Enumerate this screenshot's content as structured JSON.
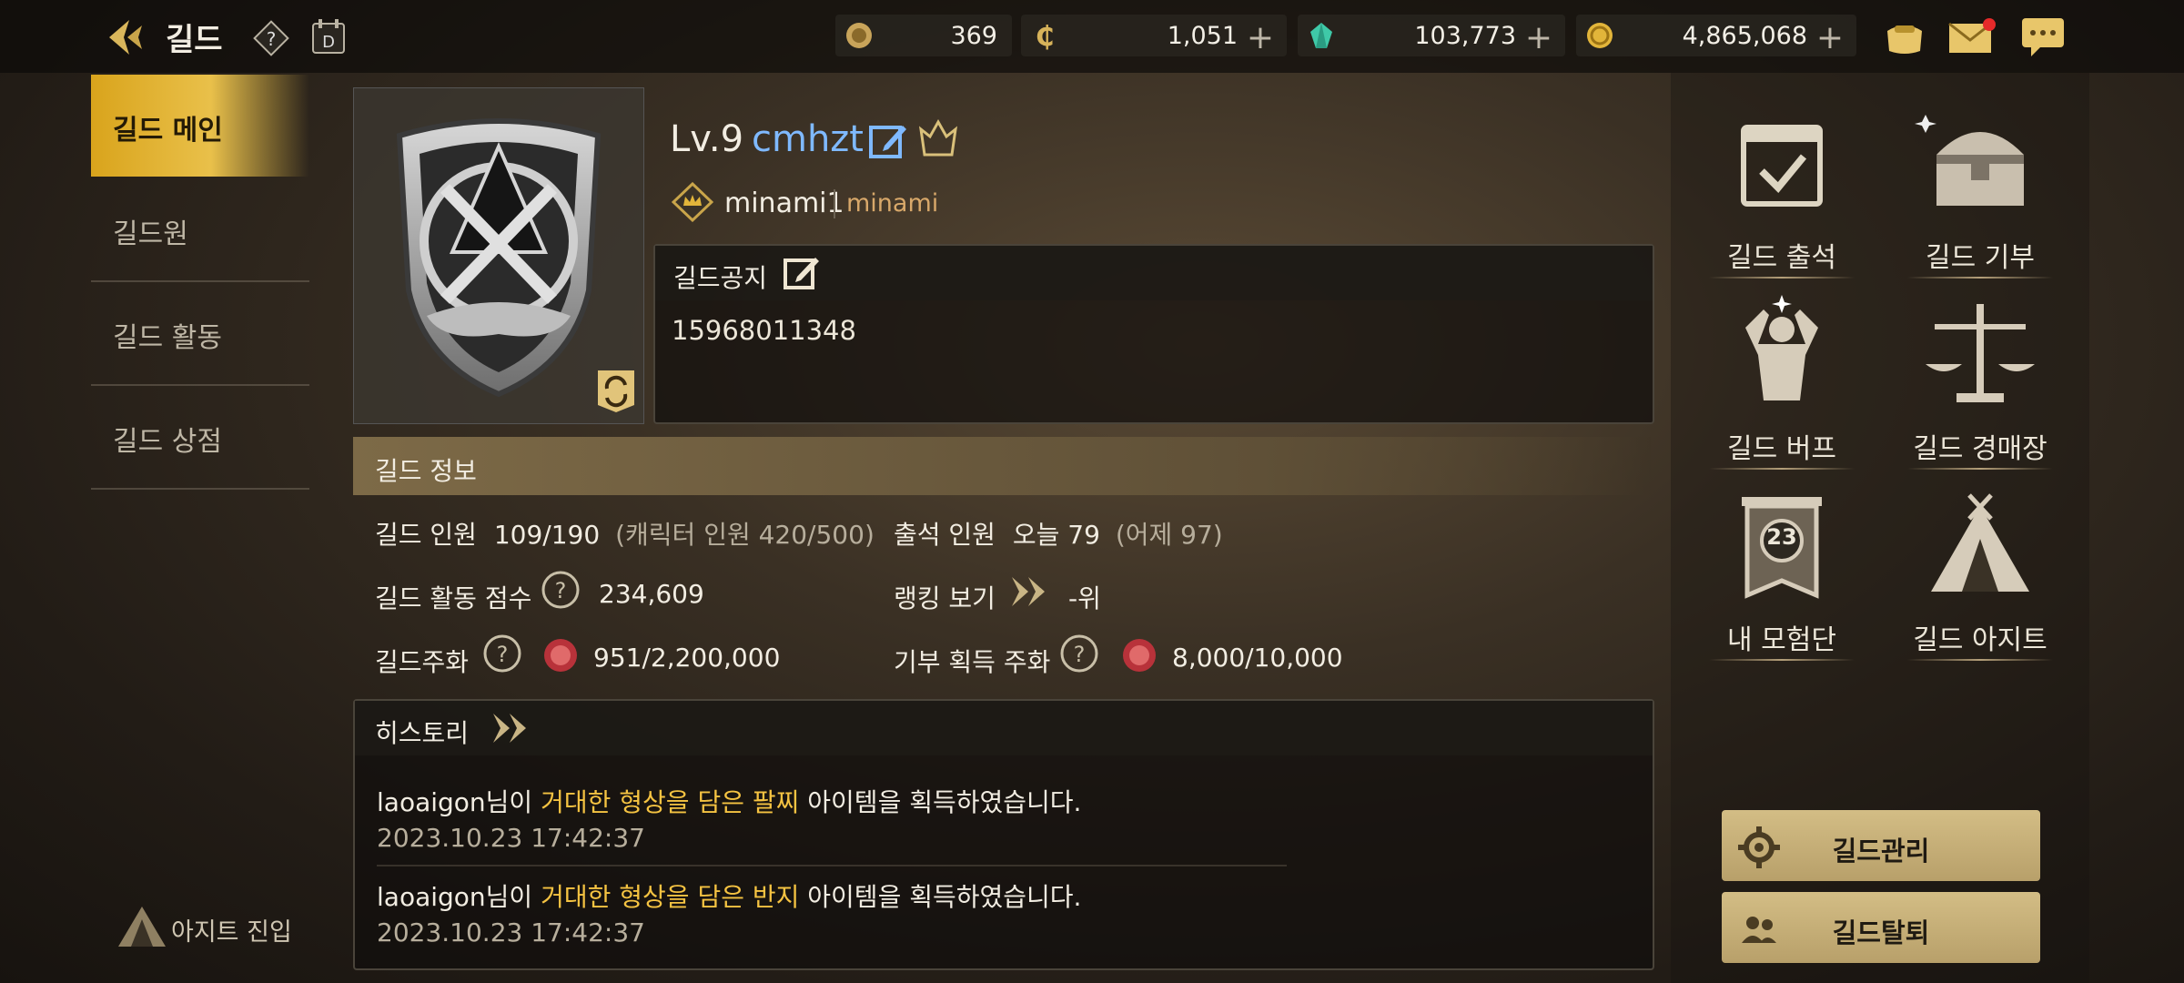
{
  "topbar": {
    "title": "길드",
    "currencies": [
      {
        "icon": "sun-medal-icon",
        "value": "369",
        "plus": false
      },
      {
        "icon": "c-coin-icon",
        "value": "1,051",
        "plus": true
      },
      {
        "icon": "green-gem-icon",
        "value": "103,773",
        "plus": true
      },
      {
        "icon": "gold-coin-icon",
        "value": "4,865,068",
        "plus": true
      }
    ],
    "right_icons": [
      "bag-icon",
      "mail-icon",
      "chat-icon"
    ]
  },
  "nav": {
    "items": [
      {
        "label": "길드 메인",
        "selected": true
      },
      {
        "label": "길드원",
        "selected": false
      },
      {
        "label": "길드 활동",
        "selected": false
      },
      {
        "label": "길드 상점",
        "selected": false
      }
    ],
    "hideout_enter": "아지트 진입"
  },
  "guild": {
    "level": "Lv.9",
    "name": "cmhzt",
    "master_name": "minami1",
    "master_sub": "minami",
    "notice_title": "길드공지",
    "notice_text": "15968011348",
    "info_title": "길드 정보",
    "members_label": "길드 인원",
    "members_value": "109/190",
    "members_char": "(캐릭터 인원 420/500)",
    "attend_label": "출석 인원",
    "attend_today": "오늘 79",
    "attend_yesterday": "(어제 97)",
    "activity_label": "길드 활동 점수",
    "activity_value": "234,609",
    "ranking_label": "랭킹 보기",
    "ranking_value": "-위",
    "coin_label": "길드주화",
    "coin_value": "951/2,200,000",
    "donate_coin_label": "기부 획득 주화",
    "donate_coin_value": "8,000/10,000"
  },
  "history": {
    "title": "히스토리",
    "entries": [
      {
        "user": "laoaigon",
        "suffix1": "님이 ",
        "item": "거대한 형상을 담은 팔찌",
        "suffix2": " 아이템을 획득하였습니다.",
        "time": "2023.10.23 17:42:37"
      },
      {
        "user": "laoaigon",
        "suffix1": "님이 ",
        "item": "거대한 형상을 담은 반지",
        "suffix2": " 아이템을 획득하였습니다.",
        "time": "2023.10.23 17:42:37"
      }
    ]
  },
  "side_menu": [
    {
      "label": "길드 출석",
      "icon": "calendar-check-icon"
    },
    {
      "label": "길드 기부",
      "icon": "treasure-chest-icon"
    },
    {
      "label": "길드 버프",
      "icon": "muscle-man-icon"
    },
    {
      "label": "길드 경매장",
      "icon": "scales-icon"
    },
    {
      "label": "내 모험단",
      "icon": "banner-23-icon"
    },
    {
      "label": "길드 아지트",
      "icon": "tent-icon"
    }
  ],
  "adventure_badge": "23",
  "buttons": {
    "manage": "길드관리",
    "leave": "길드탈퇴"
  },
  "colors": {
    "accent_gold": "#e2b53a",
    "item_highlight": "#f5c342",
    "guild_name_blue": "#7fb9ff"
  }
}
